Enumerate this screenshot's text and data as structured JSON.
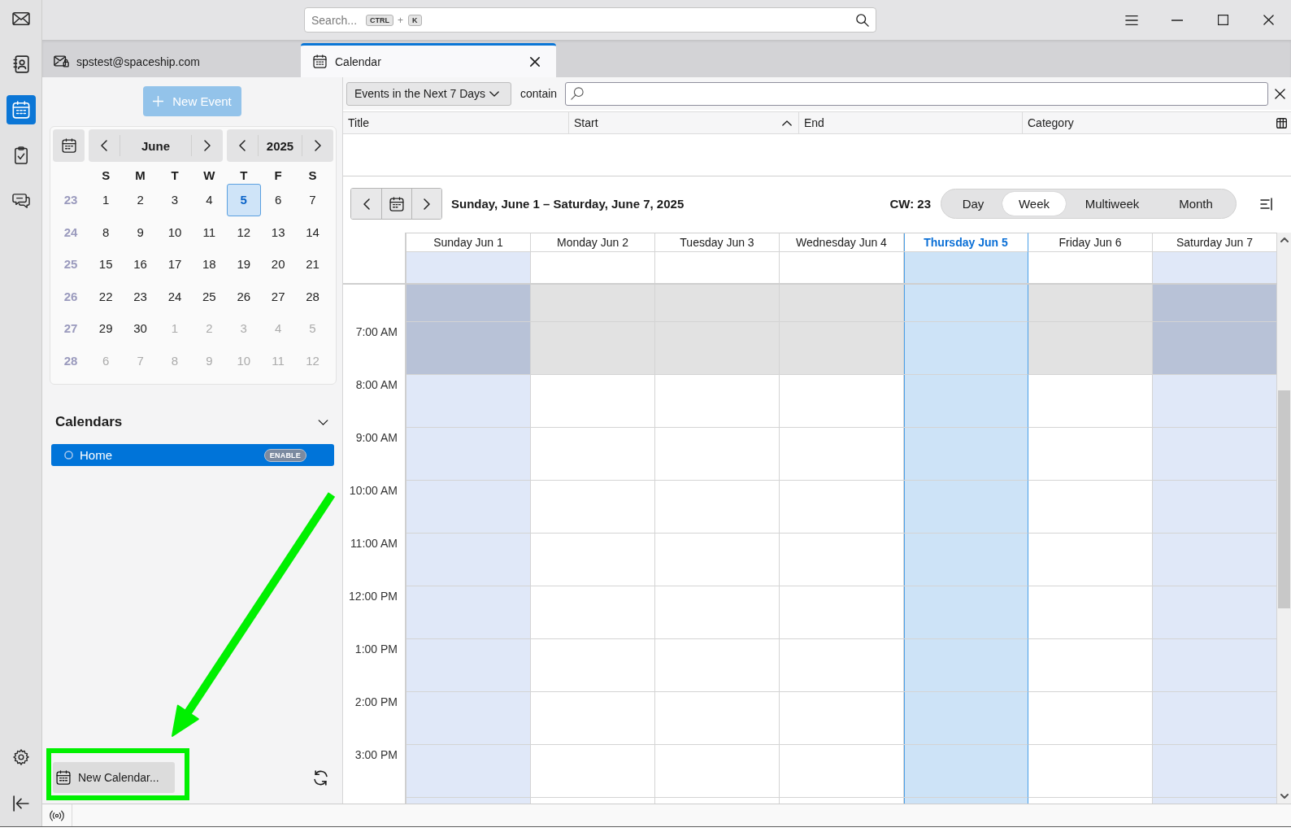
{
  "spaces": [
    {
      "kind": "mail",
      "selected": false
    },
    {
      "kind": "contacts",
      "selected": false
    },
    {
      "kind": "calendar",
      "selected": true
    },
    {
      "kind": "tasks",
      "selected": false
    },
    {
      "kind": "chat",
      "selected": false
    }
  ],
  "search": {
    "placeholder": "Search...",
    "shortcut": [
      "CTRL",
      "K"
    ],
    "shortcut_separator": "+"
  },
  "tabs": [
    {
      "kind": "mail",
      "label": "spstest@spaceship.com",
      "selected": false
    },
    {
      "kind": "calendar",
      "label": "Calendar",
      "selected": true
    }
  ],
  "new_event": {
    "label": "New Event",
    "disabled": true
  },
  "mini_calendar": {
    "month": "June",
    "year": "2025",
    "weekdays": [
      "S",
      "M",
      "T",
      "W",
      "T",
      "F",
      "S"
    ],
    "weeks": [
      {
        "number": "23",
        "days": [
          {
            "label": "1",
            "other_month": false,
            "selected": false
          },
          {
            "label": "2",
            "other_month": false,
            "selected": false
          },
          {
            "label": "3",
            "other_month": false,
            "selected": false
          },
          {
            "label": "4",
            "other_month": false,
            "selected": false
          },
          {
            "label": "5",
            "other_month": false,
            "selected": true
          },
          {
            "label": "6",
            "other_month": false,
            "selected": false
          },
          {
            "label": "7",
            "other_month": false,
            "selected": false
          }
        ]
      },
      {
        "number": "24",
        "days": [
          {
            "label": "8",
            "other_month": false,
            "selected": false
          },
          {
            "label": "9",
            "other_month": false,
            "selected": false
          },
          {
            "label": "10",
            "other_month": false,
            "selected": false
          },
          {
            "label": "11",
            "other_month": false,
            "selected": false
          },
          {
            "label": "12",
            "other_month": false,
            "selected": false
          },
          {
            "label": "13",
            "other_month": false,
            "selected": false
          },
          {
            "label": "14",
            "other_month": false,
            "selected": false
          }
        ]
      },
      {
        "number": "25",
        "days": [
          {
            "label": "15",
            "other_month": false,
            "selected": false
          },
          {
            "label": "16",
            "other_month": false,
            "selected": false
          },
          {
            "label": "17",
            "other_month": false,
            "selected": false
          },
          {
            "label": "18",
            "other_month": false,
            "selected": false
          },
          {
            "label": "19",
            "other_month": false,
            "selected": false
          },
          {
            "label": "20",
            "other_month": false,
            "selected": false
          },
          {
            "label": "21",
            "other_month": false,
            "selected": false
          }
        ]
      },
      {
        "number": "26",
        "days": [
          {
            "label": "22",
            "other_month": false,
            "selected": false
          },
          {
            "label": "23",
            "other_month": false,
            "selected": false
          },
          {
            "label": "24",
            "other_month": false,
            "selected": false
          },
          {
            "label": "25",
            "other_month": false,
            "selected": false
          },
          {
            "label": "26",
            "other_month": false,
            "selected": false
          },
          {
            "label": "27",
            "other_month": false,
            "selected": false
          },
          {
            "label": "28",
            "other_month": false,
            "selected": false
          }
        ]
      },
      {
        "number": "27",
        "days": [
          {
            "label": "29",
            "other_month": false,
            "selected": false
          },
          {
            "label": "30",
            "other_month": false,
            "selected": false
          },
          {
            "label": "1",
            "other_month": true,
            "selected": false
          },
          {
            "label": "2",
            "other_month": true,
            "selected": false
          },
          {
            "label": "3",
            "other_month": true,
            "selected": false
          },
          {
            "label": "4",
            "other_month": true,
            "selected": false
          },
          {
            "label": "5",
            "other_month": true,
            "selected": false
          }
        ]
      },
      {
        "number": "28",
        "days": [
          {
            "label": "6",
            "other_month": true,
            "selected": false
          },
          {
            "label": "7",
            "other_month": true,
            "selected": false
          },
          {
            "label": "8",
            "other_month": true,
            "selected": false
          },
          {
            "label": "9",
            "other_month": true,
            "selected": false
          },
          {
            "label": "10",
            "other_month": true,
            "selected": false
          },
          {
            "label": "11",
            "other_month": true,
            "selected": false
          },
          {
            "label": "12",
            "other_month": true,
            "selected": false
          }
        ]
      }
    ]
  },
  "calendars": {
    "title": "Calendars",
    "expanded": true,
    "items": [
      {
        "name": "Home",
        "selected": true,
        "enabled": false,
        "action": "ENABLE"
      }
    ]
  },
  "new_calendar": {
    "label": "New Calendar..."
  },
  "filter": {
    "range": "Events in the Next 7 Days",
    "operator": "contain"
  },
  "event_list": {
    "columns": [
      {
        "label": "Title",
        "sorted": false
      },
      {
        "label": "Start",
        "sorted": true
      },
      {
        "label": "End",
        "sorted": false
      },
      {
        "label": "Category",
        "sorted": false
      }
    ]
  },
  "view": {
    "title": "Sunday, June 1 – Saturday, June 7, 2025",
    "week_number": "CW: 23",
    "modes": [
      {
        "label": "Day",
        "selected": false
      },
      {
        "label": "Week",
        "selected": true
      },
      {
        "label": "Multiweek",
        "selected": false
      },
      {
        "label": "Month",
        "selected": false
      }
    ]
  },
  "week": {
    "days": [
      {
        "label": "Sunday Jun 1",
        "weekend": true,
        "today": false
      },
      {
        "label": "Monday Jun 2",
        "weekend": false,
        "today": false
      },
      {
        "label": "Tuesday Jun 3",
        "weekend": false,
        "today": false
      },
      {
        "label": "Wednesday Jun 4",
        "weekend": false,
        "today": false
      },
      {
        "label": "Thursday Jun 5",
        "weekend": false,
        "today": true
      },
      {
        "label": "Friday Jun 6",
        "weekend": false,
        "today": false
      },
      {
        "label": "Saturday Jun 7",
        "weekend": true,
        "today": false
      }
    ],
    "hours": [
      {
        "off_hours": true
      },
      {
        "label": "7:00 AM",
        "off_hours": true
      },
      {
        "label": "8:00 AM",
        "off_hours": false
      },
      {
        "label": "9:00 AM",
        "off_hours": false
      },
      {
        "label": "10:00 AM",
        "off_hours": false
      },
      {
        "label": "11:00 AM",
        "off_hours": false
      },
      {
        "label": "12:00 PM",
        "off_hours": false
      },
      {
        "label": "1:00 PM",
        "off_hours": false
      },
      {
        "label": "2:00 PM",
        "off_hours": false
      },
      {
        "label": "3:00 PM",
        "off_hours": false
      },
      {
        "off_hours": false
      }
    ]
  },
  "annotation": {
    "arrow": true,
    "frame": true
  }
}
